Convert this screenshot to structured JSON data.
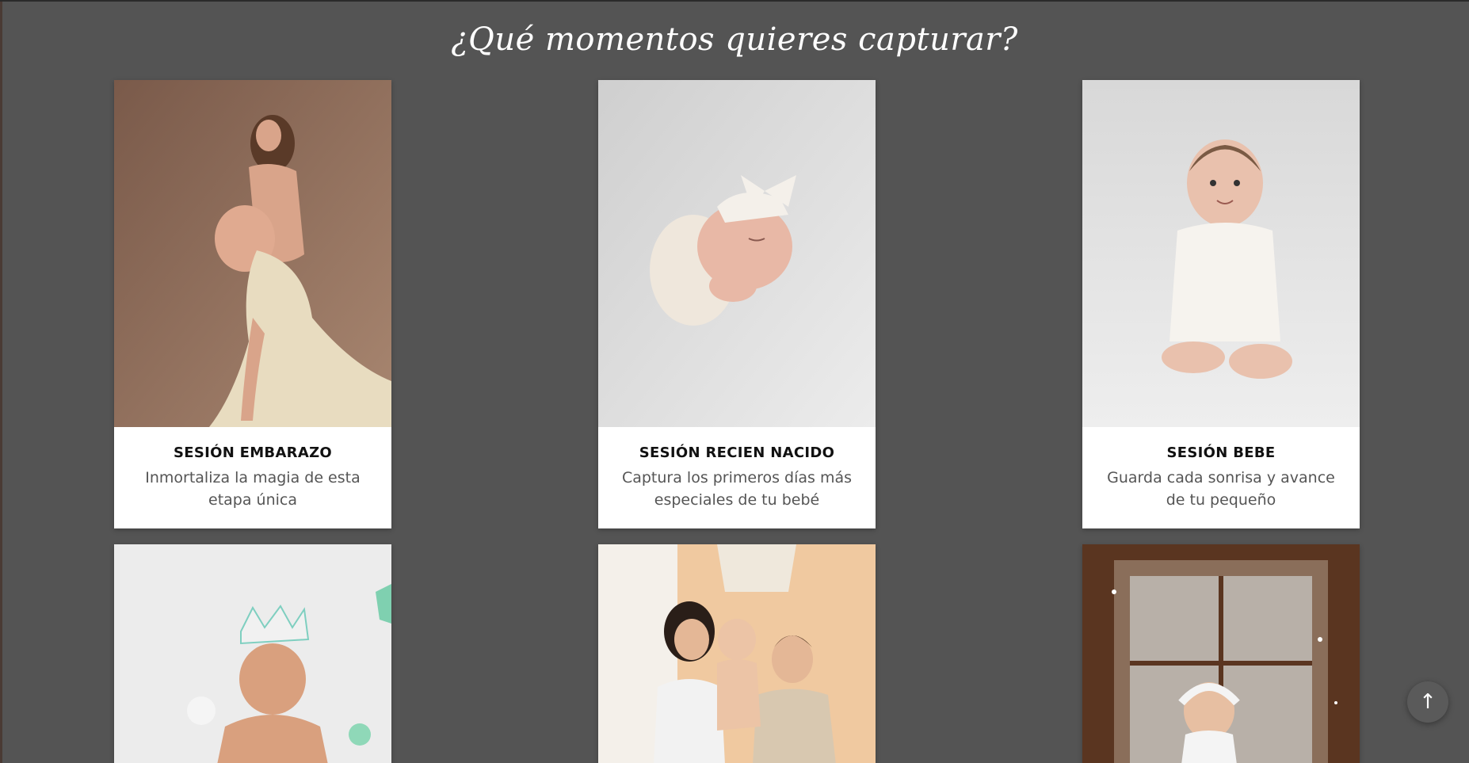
{
  "section": {
    "title": "¿Qué momentos quieres capturar?"
  },
  "cards": [
    {
      "title": "SESIÓN EMBARAZO",
      "description": "Inmortaliza la magia de esta etapa única",
      "photo_icon": "maternity-photo"
    },
    {
      "title": "SESIÓN RECIEN NACIDO",
      "description": "Captura los primeros días más especiales de tu bebé",
      "photo_icon": "newborn-photo"
    },
    {
      "title": "SESIÓN BEBE",
      "description": "Guarda cada sonrisa y avance de tu pequeño",
      "photo_icon": "baby-photo"
    },
    {
      "title": "",
      "description": "",
      "photo_icon": "smash-cake-photo"
    },
    {
      "title": "",
      "description": "",
      "photo_icon": "family-photo"
    },
    {
      "title": "",
      "description": "",
      "photo_icon": "christmas-photo"
    }
  ],
  "scroll_top": {
    "label": "↑",
    "icon": "arrow-up-icon"
  },
  "colors": {
    "background": "#545454",
    "card": "#ffffff",
    "title_text": "#111111",
    "desc_text": "#555555"
  }
}
